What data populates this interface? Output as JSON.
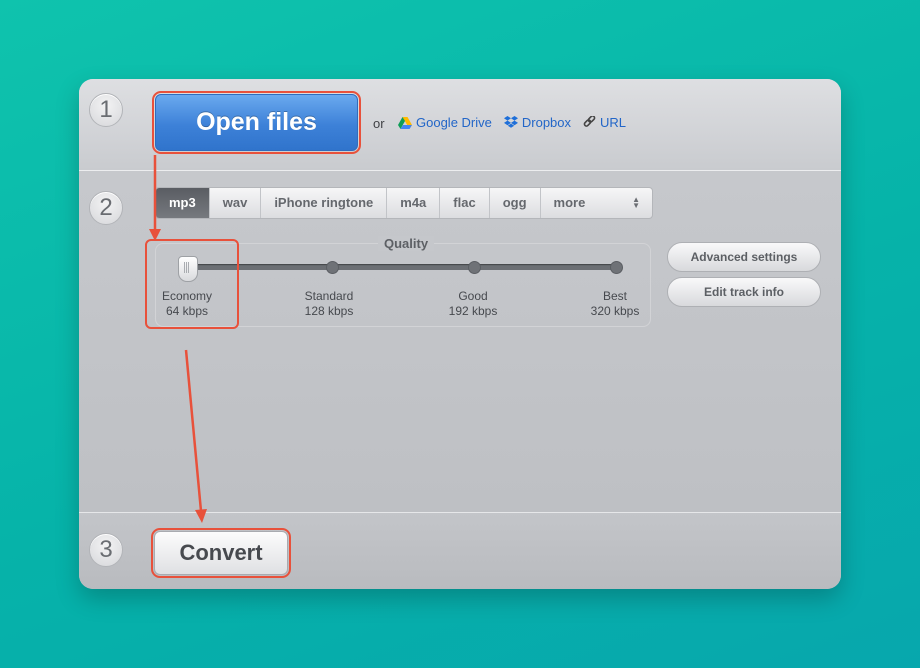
{
  "steps": [
    "1",
    "2",
    "3"
  ],
  "open": {
    "button_label": "Open files",
    "or_label": "or",
    "links": [
      {
        "label": "Google Drive",
        "icon": "google-drive-icon",
        "color": "#2266c8"
      },
      {
        "label": "Dropbox",
        "icon": "dropbox-icon",
        "color": "#2266c8"
      },
      {
        "label": "URL",
        "icon": "link-icon",
        "color": "#2266c8"
      }
    ]
  },
  "format": {
    "tabs": [
      "mp3",
      "wav",
      "iPhone ringtone",
      "m4a",
      "flac",
      "ogg",
      "more"
    ],
    "selected": "mp3"
  },
  "quality": {
    "label": "Quality",
    "options": [
      {
        "name": "Economy",
        "bitrate": "64 kbps"
      },
      {
        "name": "Standard",
        "bitrate": "128 kbps"
      },
      {
        "name": "Good",
        "bitrate": "192 kbps"
      },
      {
        "name": "Best",
        "bitrate": "320 kbps"
      }
    ],
    "selected_index": 0
  },
  "settings": {
    "advanced_label": "Advanced settings",
    "edit_track_label": "Edit track info"
  },
  "convert": {
    "button_label": "Convert"
  },
  "colors": {
    "background": "#06b3a9",
    "primary_button": "#3d81d8",
    "annotation": "#e8513b",
    "link": "#2266c8"
  }
}
